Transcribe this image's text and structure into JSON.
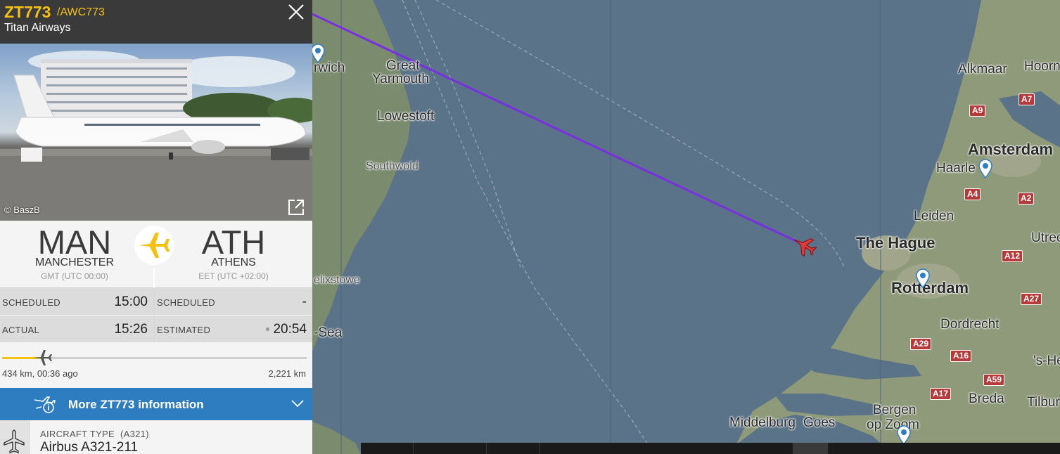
{
  "flight": {
    "number": "ZT773",
    "icao": "/AWC773",
    "airline": "Titan Airways",
    "photo_credit": "© BaszB"
  },
  "route": {
    "origin": {
      "code": "MAN",
      "city": "MANCHESTER",
      "tz": "GMT (UTC 00:00)"
    },
    "destination": {
      "code": "ATH",
      "city": "ATHENS",
      "tz": "EET (UTC +02:00)"
    }
  },
  "times": {
    "departure": {
      "scheduled_label": "SCHEDULED",
      "scheduled": "15:00",
      "actual_label": "ACTUAL",
      "actual": "15:26"
    },
    "arrival": {
      "scheduled_label": "SCHEDULED",
      "scheduled": "-",
      "estimated_label": "ESTIMATED",
      "estimated": "20:54"
    }
  },
  "progress": {
    "flown": "434 km, 00:36 ago",
    "remaining": "2,221 km",
    "fraction": 0.14
  },
  "more_info": {
    "label": "More ZT773 information"
  },
  "aircraft": {
    "type_label": "AIRCRAFT TYPE",
    "type_code": "(A321)",
    "model": "Airbus A321-211"
  },
  "map": {
    "labels": [
      {
        "text": "rwich",
        "size": "mid"
      },
      {
        "text": "Great",
        "size": "mid"
      },
      {
        "text": "Yarmouth",
        "size": "mid"
      },
      {
        "text": "Lowestoft",
        "size": "mid"
      },
      {
        "text": "Southwold",
        "size": "sm"
      },
      {
        "text": "elixstowe",
        "size": "sm"
      },
      {
        "text": "-Sea",
        "size": "mid"
      },
      {
        "text": "Alkmaar",
        "size": "mid"
      },
      {
        "text": "Hoorn",
        "size": "mid"
      },
      {
        "text": "Amsterdam",
        "size": "big"
      },
      {
        "text": "Haarle",
        "size": "mid"
      },
      {
        "text": "Leiden",
        "size": "mid"
      },
      {
        "text": "Utrec",
        "size": "mid"
      },
      {
        "text": "The Hague",
        "size": "big"
      },
      {
        "text": "Rotterdam",
        "size": "big"
      },
      {
        "text": "Dordrecht",
        "size": "mid"
      },
      {
        "text": "'s-He",
        "size": "mid"
      },
      {
        "text": "Breda",
        "size": "mid"
      },
      {
        "text": "Tilbur",
        "size": "mid"
      },
      {
        "text": "Bergen",
        "size": "mid"
      },
      {
        "text": "op Zoom",
        "size": "mid"
      },
      {
        "text": "Middelburg",
        "size": "mid"
      },
      {
        "text": "Goes",
        "size": "mid"
      }
    ],
    "roads": [
      "A7",
      "A9",
      "A4",
      "A2",
      "A12",
      "A27",
      "A29",
      "A16",
      "A59",
      "A17"
    ],
    "route_color": "#7a2fe0",
    "aircraft_color": "#e03a3a"
  },
  "colors": {
    "accent": "#f3c013",
    "button": "#2f7dc1",
    "header": "#3a3a3a"
  }
}
